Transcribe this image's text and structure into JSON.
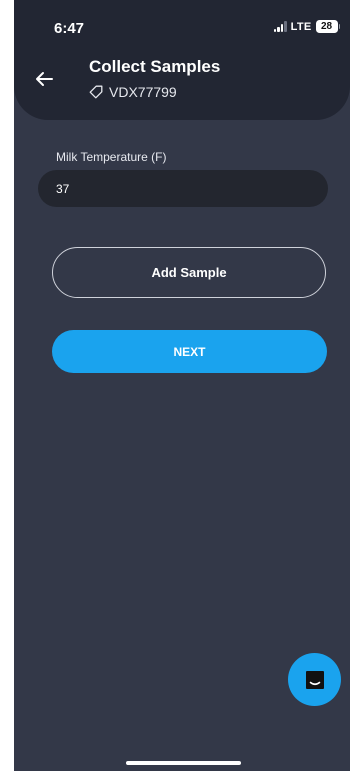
{
  "status_bar": {
    "time": "6:47",
    "network": "LTE",
    "battery": "28"
  },
  "header": {
    "title": "Collect Samples",
    "tag": "VDX77799",
    "back_icon": "arrow-left-icon",
    "tag_icon": "tag-icon"
  },
  "form": {
    "temperature_label": "Milk Temperature (F)",
    "temperature_value": "37"
  },
  "buttons": {
    "add_sample": "Add Sample",
    "next": "NEXT"
  },
  "chat": {
    "icon": "chat-icon"
  },
  "colors": {
    "background": "#333848",
    "header": "#222633",
    "accent": "#1aa3ee",
    "input_bg": "#23262f"
  }
}
